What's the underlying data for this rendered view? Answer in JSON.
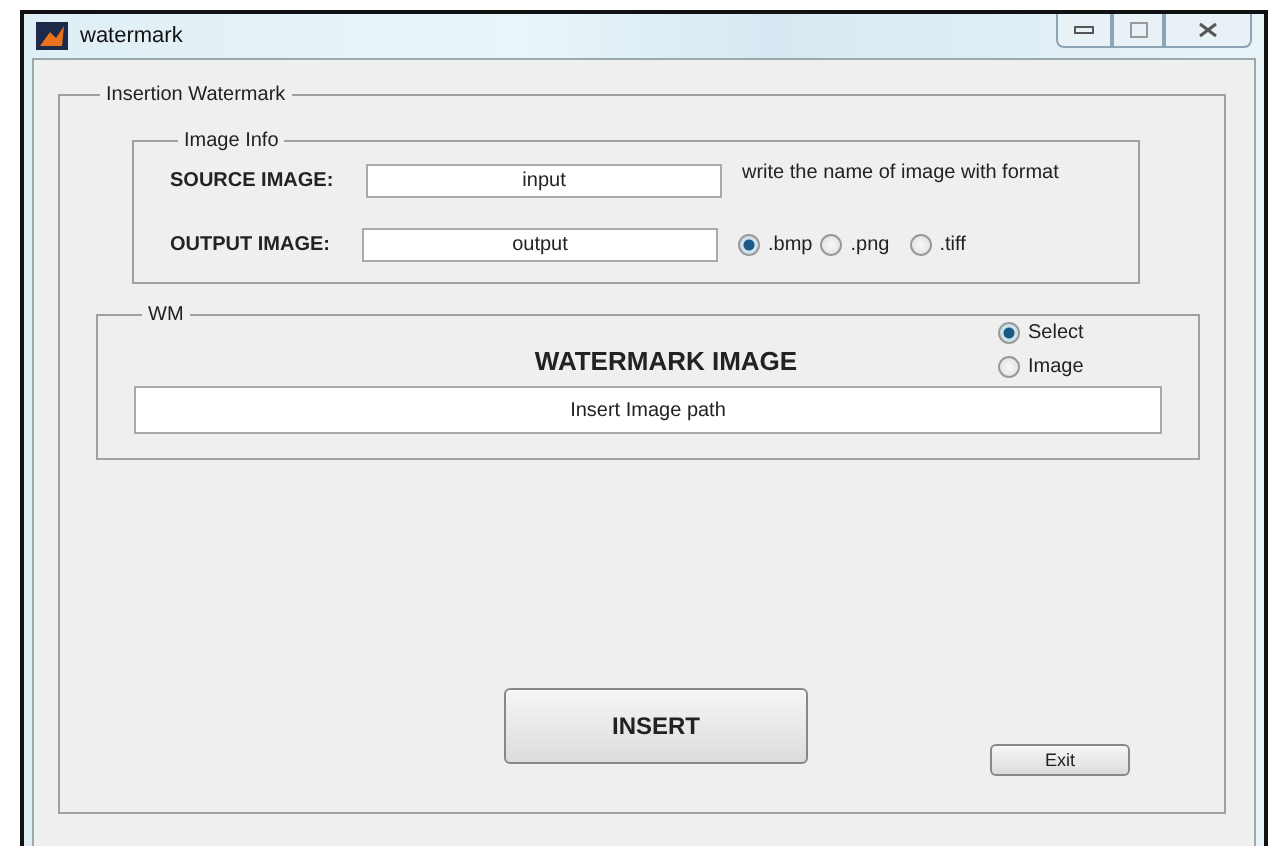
{
  "window": {
    "title": "watermark"
  },
  "panel": {
    "title": "Insertion Watermark"
  },
  "image_info": {
    "title": "Image Info",
    "source": {
      "label": "SOURCE IMAGE:",
      "value": "input"
    },
    "hint": "write the name of image with format",
    "output": {
      "label": "OUTPUT IMAGE:",
      "value": "output"
    },
    "formats": [
      {
        "label": ".bmp",
        "selected": true
      },
      {
        "label": ".png",
        "selected": false
      },
      {
        "label": ".tiff",
        "selected": false
      }
    ]
  },
  "wm": {
    "title": "WM",
    "heading": "WATERMARK IMAGE",
    "options": [
      {
        "label": "Select",
        "selected": true
      },
      {
        "label": "Image",
        "selected": false
      }
    ],
    "path": {
      "value": "Insert Image path"
    }
  },
  "buttons": {
    "insert": "INSERT",
    "exit": "Exit"
  }
}
